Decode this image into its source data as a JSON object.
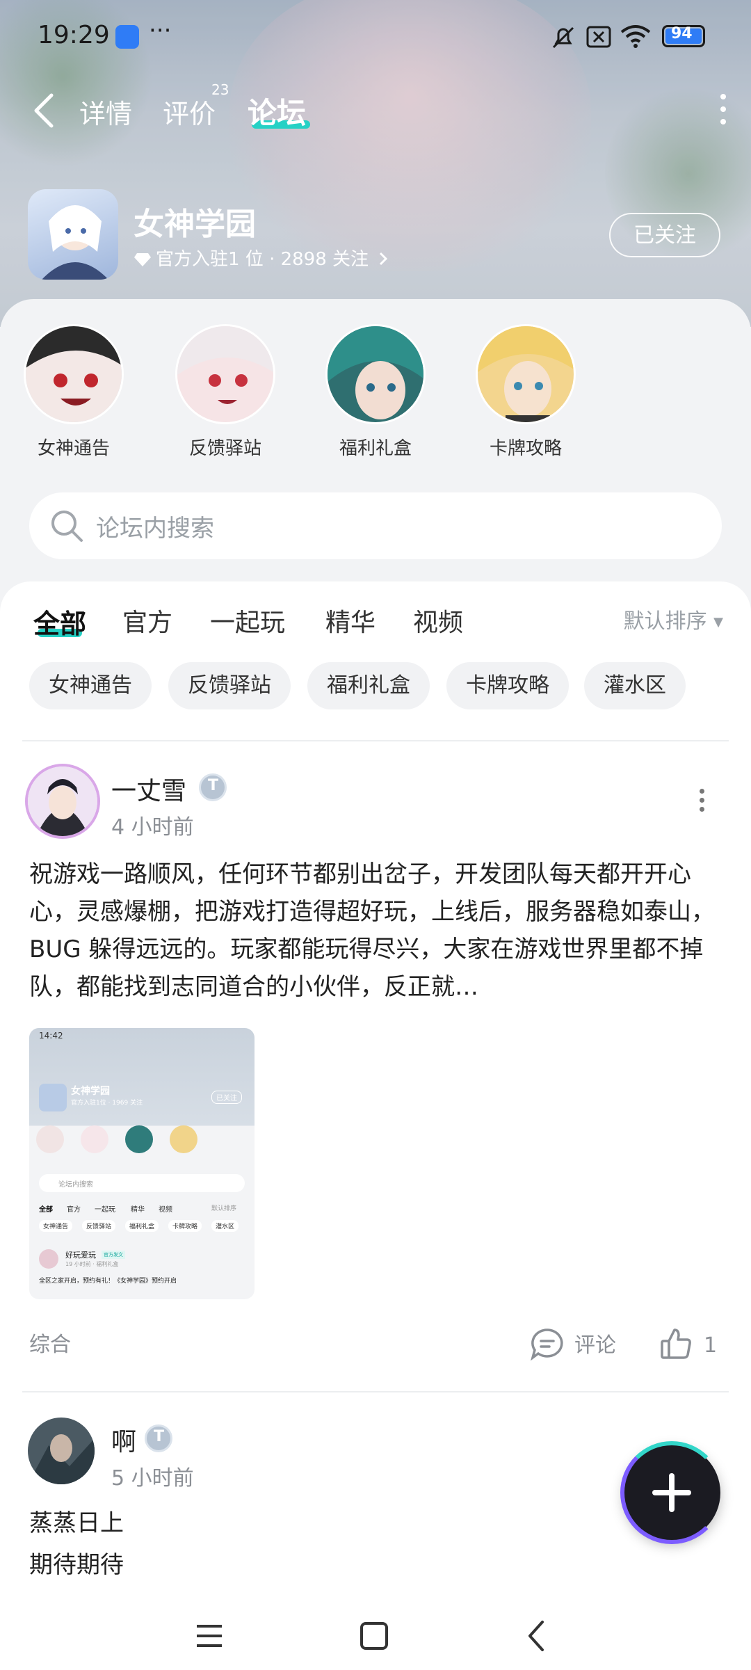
{
  "status": {
    "time": "19:29",
    "more": "···",
    "battery": "94"
  },
  "nav": {
    "tabs": [
      {
        "label": "详情"
      },
      {
        "label": "评价",
        "count": "23"
      },
      {
        "label": "论坛"
      }
    ],
    "active_tab": 2
  },
  "game": {
    "title": "女神学园",
    "subtitle": "官方入驻1 位 · 2898 关注",
    "follow_label": "已关注"
  },
  "sections": [
    {
      "label": "女神通告",
      "color": "#b8d2ea"
    },
    {
      "label": "反馈驿站",
      "color": "#efd4d9"
    },
    {
      "label": "福利礼盒",
      "color": "#3f8c8a"
    },
    {
      "label": "卡牌攻略",
      "color": "#f0d58a"
    }
  ],
  "search": {
    "placeholder": "论坛内搜索"
  },
  "filters": {
    "tabs": [
      "全部",
      "官方",
      "一起玩",
      "精华",
      "视频"
    ],
    "active": 0,
    "sort_label": "默认排序"
  },
  "chips": [
    "女神通告",
    "反馈驿站",
    "福利礼盒",
    "卡牌攻略",
    "灌水区"
  ],
  "posts": [
    {
      "user": "一丈雪",
      "time": "4 小时前",
      "body": "祝游戏一路顺风，任何环节都别出岔子，开发团队每天都开开心心，灵感爆棚，把游戏打造得超好玩，上线后，服务器稳如泰山， BUG 躲得远远的。玩家都能玩得尽兴，大家在游戏世界里都不掉队，都能找到志同道合的小伙伴，反正就…",
      "tag": "综合",
      "comment_label": "评论",
      "likes": "1",
      "thumb": {
        "time": "14:42",
        "title": "女神学园",
        "sub": "官方入驻1位 · 1969 关注",
        "follow": "已关注",
        "search": "论坛内搜索",
        "tabs": [
          "全部",
          "官方",
          "一起玩",
          "精华",
          "视频"
        ],
        "sort": "默认排序",
        "chips": [
          "女神通告",
          "反馈驿站",
          "福利礼盒",
          "卡牌攻略",
          "灌水区"
        ],
        "post_user": "好玩爱玩",
        "post_badge": "官方发文",
        "post_time": "19 小时前 · 福利礼盒",
        "post_line": "全区之家开启，预约有礼！《女神学园》预约开启"
      }
    },
    {
      "user": "啊",
      "time": "5 小时前",
      "body_lines": [
        "蒸蒸日上",
        "期待期待"
      ]
    }
  ]
}
